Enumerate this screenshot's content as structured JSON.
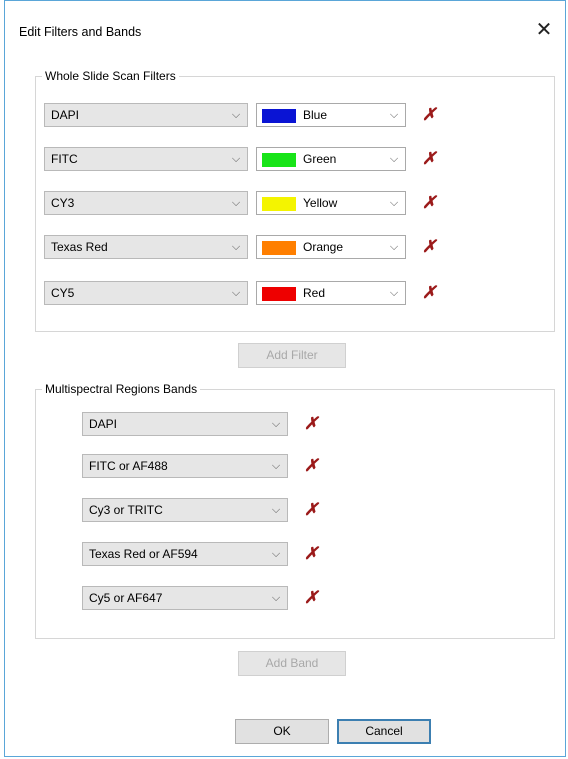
{
  "dialog": {
    "title": "Edit Filters and Bands",
    "close_glyph": "✕"
  },
  "filters": {
    "group_label": "Whole Slide Scan Filters",
    "rows": [
      {
        "filter": "DAPI",
        "color_name": "Blue",
        "color_hex": "#0a14d4"
      },
      {
        "filter": "FITC",
        "color_name": "Green",
        "color_hex": "#18e418"
      },
      {
        "filter": "CY3",
        "color_name": "Yellow",
        "color_hex": "#f4f400"
      },
      {
        "filter": "Texas Red",
        "color_name": "Orange",
        "color_hex": "#ff7f00"
      },
      {
        "filter": "CY5",
        "color_name": "Red",
        "color_hex": "#ee0000"
      }
    ],
    "add_label": "Add Filter"
  },
  "bands": {
    "group_label": "Multispectral Regions Bands",
    "rows": [
      {
        "band": "DAPI"
      },
      {
        "band": "FITC or AF488"
      },
      {
        "band": "Cy3 or TRITC"
      },
      {
        "band": "Texas Red or AF594"
      },
      {
        "band": "Cy5 or AF647"
      }
    ],
    "add_label": "Add Band"
  },
  "icons": {
    "dropdown": "chevron-down-icon",
    "delete": "delete-x-icon",
    "close": "close-icon"
  },
  "glyphs": {
    "chevron": "⌵",
    "delete": "✗"
  },
  "footer": {
    "ok_label": "OK",
    "cancel_label": "Cancel"
  },
  "colors": {
    "accent_border": "#3c7fb1",
    "delete_x": "#9b1a1a"
  }
}
